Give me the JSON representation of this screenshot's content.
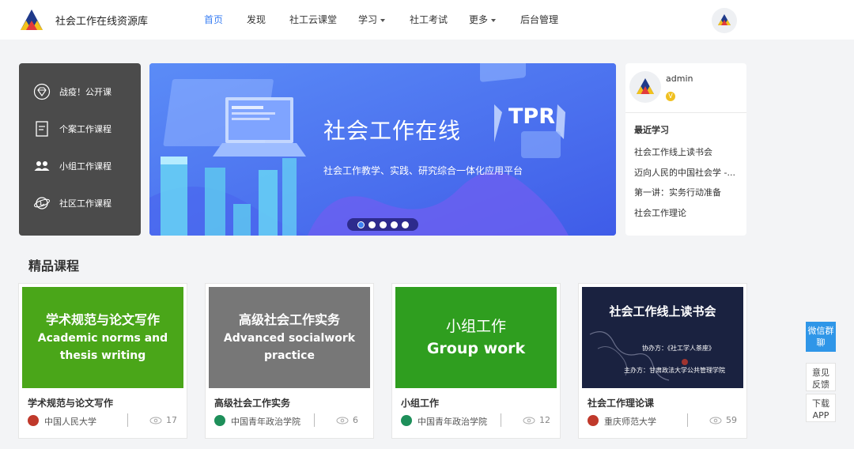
{
  "header": {
    "site_title": "社会工作在线资源库",
    "nav": [
      {
        "label": "首页",
        "active": true,
        "dropdown": false
      },
      {
        "label": "发现",
        "active": false,
        "dropdown": false
      },
      {
        "label": "社工云课堂",
        "active": false,
        "dropdown": false
      },
      {
        "label": "学习",
        "active": false,
        "dropdown": true
      },
      {
        "label": "社工考试",
        "active": false,
        "dropdown": false
      },
      {
        "label": "更多",
        "active": false,
        "dropdown": true
      },
      {
        "label": "后台管理",
        "active": false,
        "dropdown": false
      }
    ]
  },
  "side_menu": {
    "items": [
      {
        "label": "战疫！公开课",
        "icon": "diamond-icon"
      },
      {
        "label": "个案工作课程",
        "icon": "document-icon"
      },
      {
        "label": "小组工作课程",
        "icon": "group-icon"
      },
      {
        "label": "社区工作课程",
        "icon": "globe-icon"
      }
    ]
  },
  "banner": {
    "title": "社会工作在线",
    "subtitle": "社会工作教学、实践、研究综合一体化应用平台",
    "badge_text": "TPR",
    "slide_count": 5,
    "active_slide": 1
  },
  "user": {
    "name": "admin",
    "badge": "V",
    "recent_title": "最近学习",
    "recent": [
      "社会工作线上读书会",
      "迈向人民的中国社会学 -...",
      "第一讲：实务行动准备",
      "社会工作理论"
    ]
  },
  "section": {
    "title": "精品课程"
  },
  "courses": [
    {
      "cover_cn": "学术规范与论文写作",
      "cover_en": "Academic norms and thesis writing",
      "cover_color": "#4aa619",
      "name": "学术规范与论文写作",
      "school": "中国人民大学",
      "school_color": "#c0392b",
      "views": "17"
    },
    {
      "cover_cn": "高级社会工作实务",
      "cover_en": "Advanced socialwork practice",
      "cover_color": "#777777",
      "name": "高级社会工作实务",
      "school": "中国青年政治学院",
      "school_color": "#1e8f5a",
      "views": "6"
    },
    {
      "cover_cn": "小组工作",
      "cover_en": "Group work",
      "cover_color": "#2f9e1f",
      "name": "小组工作",
      "school": "中国青年政治学院",
      "school_color": "#1e8f5a",
      "views": "12"
    },
    {
      "cover_cn": "社会工作线上读书会",
      "cover_en": "",
      "cover_color": "#1a2240",
      "cover_line1": "协办方：《社工学人茶座》",
      "cover_line2": "主办方：甘肃政法大学公共管理学院",
      "name": "社会工作理论课",
      "school": "重庆师范大学",
      "school_color": "#c0392b",
      "views": "59"
    }
  ],
  "float": {
    "wechat": "微信群聊",
    "feedback": "意见反馈",
    "app": "下载APP"
  },
  "colors": {
    "accent": "#3b7ff3",
    "banner_bg": "#4c6ef0",
    "side_bg": "#4b4b4b"
  }
}
